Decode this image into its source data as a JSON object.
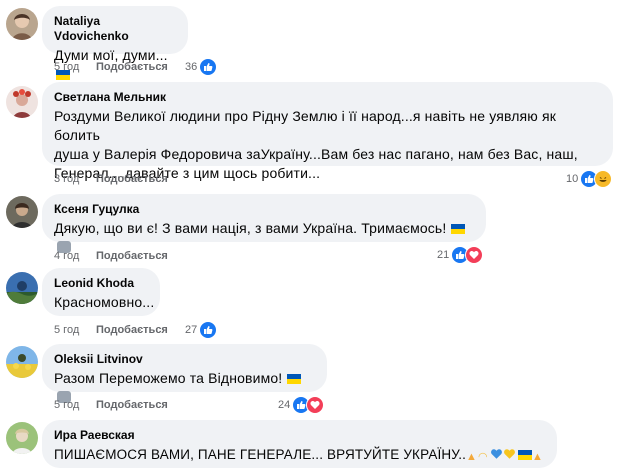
{
  "comments": [
    {
      "author": "Nataliya Vdovichenko",
      "text": "Думи мої, думи...",
      "time": "5 год",
      "like_label": "Подобається",
      "reaction_count": "36"
    },
    {
      "author": "Светлана Мельник",
      "text_lines": [
        "Роздуми Великої людини про Рідну Землю і її народ...я навіть не уявляю як болить",
        "душа у Валерія Федоровича заУкраїну...Вам без нас пагано, нам без Вас, наш,",
        "Генерал....давайте з цим щось робити..."
      ],
      "time": "3 год",
      "like_label": "Подобається",
      "reaction_count": "10"
    },
    {
      "author": "Ксеня Гуцулка",
      "text": "Дякую, що ви є! З вами нація, з вами Україна. Тримаємось!",
      "time": "4 год",
      "like_label": "Подобається",
      "reaction_count": "21"
    },
    {
      "author": "Leonid Khoda",
      "text": "Красномовно...",
      "time": "5 год",
      "like_label": "Подобається",
      "reaction_count": "27"
    },
    {
      "author": "Oleksii Litvinov",
      "text": "Разом Переможемо та Відновимо!",
      "time": "5 год",
      "like_label": "Подобається",
      "reaction_count": "24"
    },
    {
      "author": "Ира Раевская",
      "text": "ПИШАЄМОСЯ ВАМИ, ПАНЕ ГЕНЕРАЛЕ... ВРЯТУЙТЕ УКРАЇНУ..",
      "time": "",
      "like_label": "",
      "reaction_count": ""
    }
  ],
  "colors": {
    "bubble": "#f0f2f5",
    "meta": "#65676b",
    "like": "#1877f2",
    "love": "#f33e58",
    "haha": "#f7b928",
    "flag_blue": "#0057b7",
    "flag_yellow": "#ffd700"
  }
}
